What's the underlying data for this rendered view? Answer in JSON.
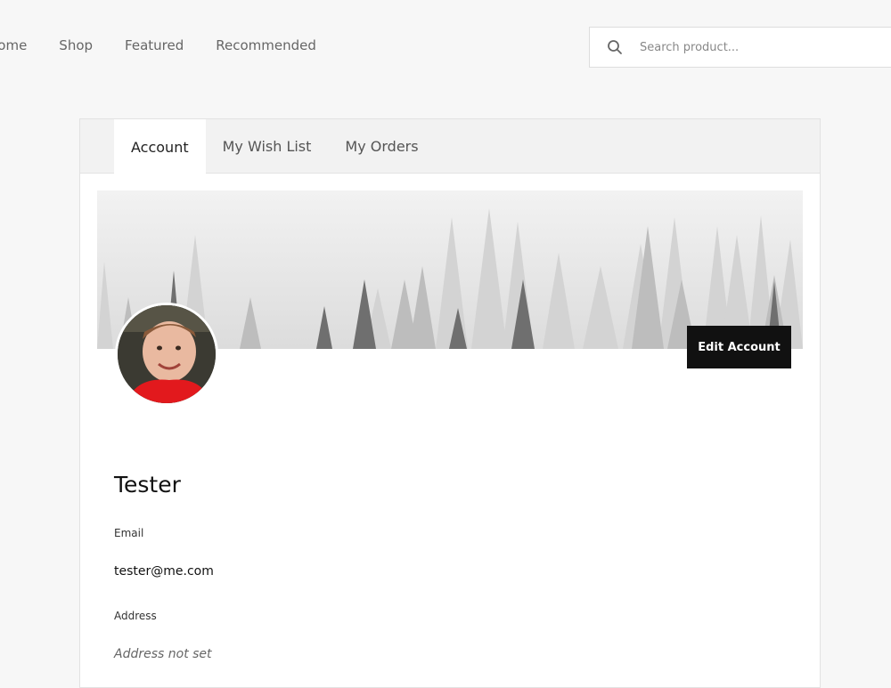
{
  "nav": {
    "items": [
      {
        "label": "Home"
      },
      {
        "label": "Shop"
      },
      {
        "label": "Featured"
      },
      {
        "label": "Recommended"
      }
    ]
  },
  "search": {
    "placeholder": "Search product...",
    "value": "",
    "icon": "search-icon"
  },
  "tabs": [
    {
      "label": "Account",
      "active": true
    },
    {
      "label": "My Wish List",
      "active": false
    },
    {
      "label": "My Orders",
      "active": false
    }
  ],
  "profile": {
    "edit_label": "Edit Account",
    "name": "Tester",
    "email_label": "Email",
    "email": "tester@me.com",
    "address_label": "Address",
    "address": "Address not set"
  },
  "colors": {
    "button_bg": "#111111",
    "page_bg": "#f7f7f7",
    "tabbar_bg": "#f2f2f2"
  }
}
